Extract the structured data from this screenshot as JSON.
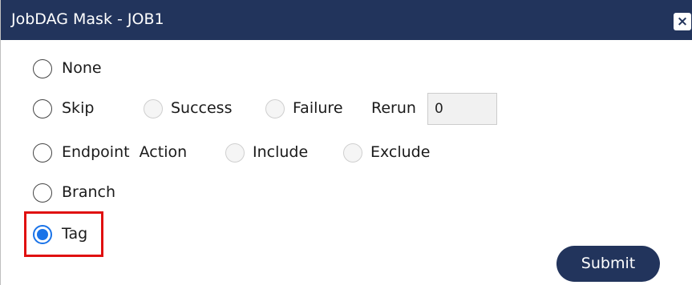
{
  "dialog": {
    "title": "JobDAG Mask - JOB1",
    "close_label": "×"
  },
  "options": {
    "none": {
      "label": "None",
      "checked": false
    },
    "skip": {
      "label": "Skip",
      "checked": false,
      "success_label": "Success",
      "failure_label": "Failure",
      "rerun_label": "Rerun",
      "rerun_value": "0"
    },
    "endpoint": {
      "label": "Endpoint  Action",
      "checked": false,
      "include_label": "Include",
      "exclude_label": "Exclude"
    },
    "branch": {
      "label": "Branch",
      "checked": false
    },
    "tag": {
      "label": "Tag",
      "checked": true
    }
  },
  "actions": {
    "submit_label": "Submit"
  },
  "colors": {
    "header": "#22345c",
    "accent": "#1a73e8",
    "highlight": "#e01010"
  }
}
